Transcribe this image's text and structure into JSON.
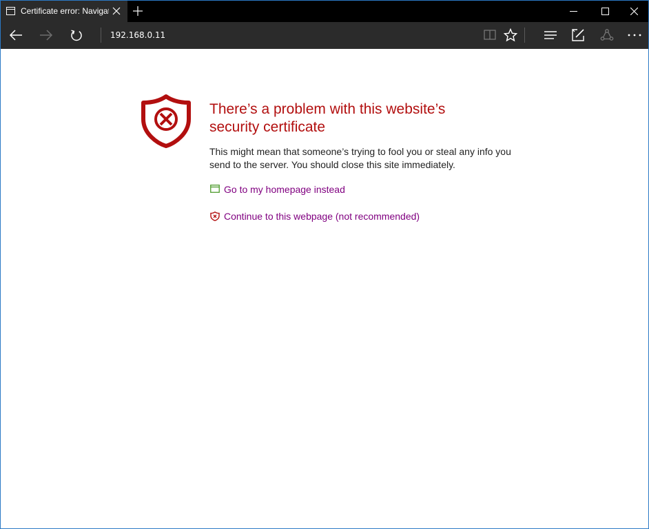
{
  "tab": {
    "title": "Certificate error: Navigation",
    "icon": "tab-page-icon",
    "close_icon": "close-icon"
  },
  "window_controls": [
    "minimize-icon",
    "maximize-icon",
    "close-icon"
  ],
  "nav": {
    "address": "192.168.0.11",
    "icons": [
      "back-arrow-icon",
      "forward-arrow-icon",
      "refresh-icon",
      "reading-view-icon",
      "favorite-star-icon",
      "hub-icon",
      "web-note-icon",
      "share-icon",
      "more-icon"
    ]
  },
  "page": {
    "heading": "There’s a problem with this website’s security certificate",
    "description": "This might mean that someone’s trying to fool you or steal any info you send to the server. You should close this site immediately.",
    "link_home": "Go to my homepage instead",
    "link_continue": "Continue to this webpage (not recommended)"
  },
  "colors": {
    "error_red": "#b20f0f",
    "link_purple": "#800080",
    "home_icon_green": "#4c9a2a",
    "chrome_dark": "#2b2b2b",
    "window_border": "#2b79c5"
  }
}
